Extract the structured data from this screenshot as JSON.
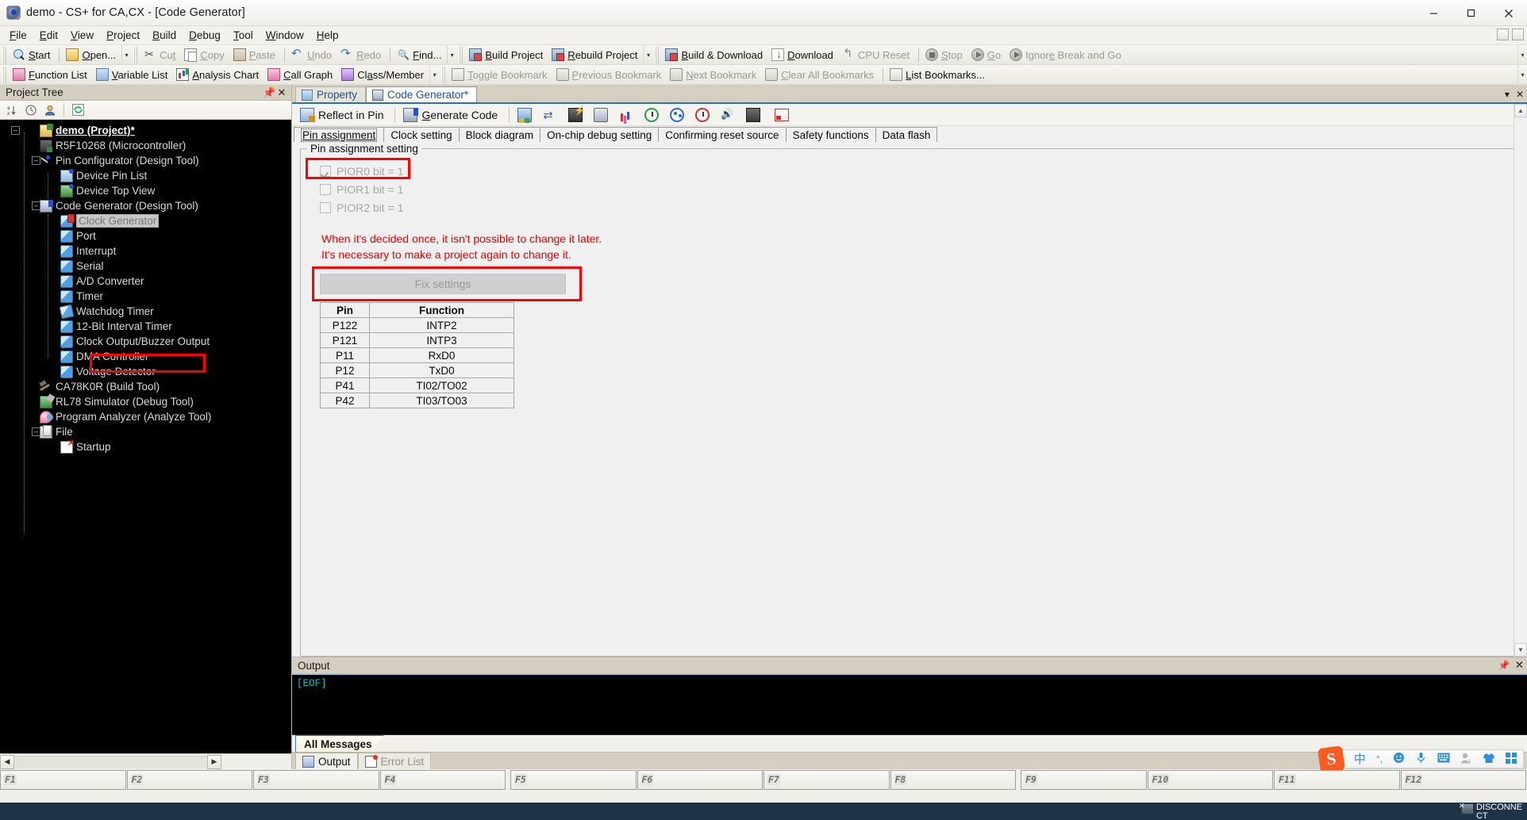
{
  "window": {
    "title": "demo - CS+ for CA,CX - [Code Generator]",
    "app_icon": "cs-plus-app-icon",
    "minimize": "minimize-icon",
    "maximize": "maximize-icon",
    "close": "close-icon"
  },
  "menubar": {
    "items": [
      {
        "label": "File",
        "mnemonic": "F"
      },
      {
        "label": "Edit",
        "mnemonic": "E"
      },
      {
        "label": "View",
        "mnemonic": "V"
      },
      {
        "label": "Project",
        "mnemonic": "P"
      },
      {
        "label": "Build",
        "mnemonic": "B"
      },
      {
        "label": "Debug",
        "mnemonic": "D"
      },
      {
        "label": "Tool",
        "mnemonic": "T"
      },
      {
        "label": "Window",
        "mnemonic": "W"
      },
      {
        "label": "Help",
        "mnemonic": "H"
      }
    ]
  },
  "toolbar_row1": [
    {
      "label": "Start",
      "icon": "start-icon",
      "disabled": false
    },
    {
      "label": "Open...",
      "icon": "open-folder-icon",
      "disabled": false
    },
    {
      "label": "Cut",
      "icon": "scissors-icon",
      "disabled": true
    },
    {
      "label": "Copy",
      "icon": "copy-icon",
      "disabled": true
    },
    {
      "label": "Paste",
      "icon": "paste-icon",
      "disabled": true
    },
    {
      "label": "Undo",
      "icon": "undo-icon",
      "disabled": true
    },
    {
      "label": "Redo",
      "icon": "redo-icon",
      "disabled": true
    },
    {
      "label": "Find...",
      "icon": "find-icon",
      "disabled": false
    },
    {
      "label": "Build Project",
      "icon": "build-project-icon",
      "disabled": false
    },
    {
      "label": "Rebuild Project",
      "icon": "rebuild-project-icon",
      "disabled": false
    },
    {
      "label": "Build & Download",
      "icon": "build-download-icon",
      "disabled": false
    },
    {
      "label": "Download",
      "icon": "download-icon",
      "disabled": false
    },
    {
      "label": "CPU Reset",
      "icon": "cpu-reset-icon",
      "disabled": true
    },
    {
      "label": "Stop",
      "icon": "stop-icon",
      "disabled": true
    },
    {
      "label": "Go",
      "icon": "go-icon",
      "disabled": true
    },
    {
      "label": "Ignore Break and Go",
      "icon": "ignore-break-go-icon",
      "disabled": true
    }
  ],
  "toolbar_row2": [
    {
      "label": "Function List",
      "icon": "function-list-icon",
      "disabled": false
    },
    {
      "label": "Variable List",
      "icon": "variable-list-icon",
      "disabled": false
    },
    {
      "label": "Analysis Chart",
      "icon": "analysis-chart-icon",
      "disabled": false
    },
    {
      "label": "Call Graph",
      "icon": "call-graph-icon",
      "disabled": false
    },
    {
      "label": "Class/Member",
      "icon": "class-member-icon",
      "disabled": false
    },
    {
      "label": "Toggle Bookmark",
      "icon": "toggle-bookmark-icon",
      "disabled": true
    },
    {
      "label": "Previous Bookmark",
      "icon": "previous-bookmark-icon",
      "disabled": true
    },
    {
      "label": "Next Bookmark",
      "icon": "next-bookmark-icon",
      "disabled": true
    },
    {
      "label": "Clear All Bookmarks",
      "icon": "clear-all-bookmarks-icon",
      "disabled": true
    },
    {
      "label": "List Bookmarks...",
      "icon": "list-bookmarks-icon",
      "disabled": false
    }
  ],
  "project_tree": {
    "title": "Project Tree",
    "pin_icon": "pin-icon",
    "close_icon": "close-icon",
    "toolbar_icons": [
      "sort-az-icon",
      "clock-icon",
      "user-icon",
      "refresh-icon"
    ],
    "nodes": [
      {
        "label": "demo (Project)*",
        "depth": 0,
        "icon": "project-icon",
        "expander": "-",
        "selected": false
      },
      {
        "label": "R5F10268 (Microcontroller)",
        "depth": 1,
        "icon": "microcontroller-icon",
        "expander": "",
        "selected": false
      },
      {
        "label": "Pin Configurator (Design Tool)",
        "depth": 1,
        "icon": "pin-configurator-icon",
        "expander": "-",
        "selected": false
      },
      {
        "label": "Device Pin List",
        "depth": 2,
        "icon": "device-pin-list-icon",
        "expander": "",
        "selected": false
      },
      {
        "label": "Device Top View",
        "depth": 2,
        "icon": "device-top-view-icon",
        "expander": "",
        "selected": false
      },
      {
        "label": "Code Generator (Design Tool)",
        "depth": 1,
        "icon": "code-generator-icon",
        "expander": "-",
        "selected": false
      },
      {
        "label": "Clock Generator",
        "depth": 2,
        "icon": "clock-generator-icon",
        "expander": "",
        "selected": true
      },
      {
        "label": "Port",
        "depth": 2,
        "icon": "port-icon",
        "expander": "",
        "selected": false
      },
      {
        "label": "Interrupt",
        "depth": 2,
        "icon": "interrupt-icon",
        "expander": "",
        "selected": false
      },
      {
        "label": "Serial",
        "depth": 2,
        "icon": "serial-icon",
        "expander": "",
        "selected": false
      },
      {
        "label": "A/D Converter",
        "depth": 2,
        "icon": "ad-converter-icon",
        "expander": "",
        "selected": false
      },
      {
        "label": "Timer",
        "depth": 2,
        "icon": "timer-icon",
        "expander": "",
        "selected": false
      },
      {
        "label": "Watchdog Timer",
        "depth": 2,
        "icon": "watchdog-timer-icon",
        "expander": "",
        "selected": false
      },
      {
        "label": "12-Bit Interval Timer",
        "depth": 2,
        "icon": "interval-timer-icon",
        "expander": "",
        "selected": false
      },
      {
        "label": "Clock Output/Buzzer Output",
        "depth": 2,
        "icon": "clock-output-icon",
        "expander": "",
        "selected": false
      },
      {
        "label": "DMA Controller",
        "depth": 2,
        "icon": "dma-controller-icon",
        "expander": "",
        "selected": false
      },
      {
        "label": "Voltage Detector",
        "depth": 2,
        "icon": "voltage-detector-icon",
        "expander": "",
        "selected": false
      },
      {
        "label": "CA78K0R (Build Tool)",
        "depth": 1,
        "icon": "build-tool-icon",
        "expander": "",
        "selected": false
      },
      {
        "label": "RL78 Simulator (Debug Tool)",
        "depth": 1,
        "icon": "debug-tool-icon",
        "expander": "",
        "selected": false
      },
      {
        "label": "Program Analyzer (Analyze Tool)",
        "depth": 1,
        "icon": "analyze-tool-icon",
        "expander": "",
        "selected": false
      },
      {
        "label": "File",
        "depth": 1,
        "icon": "file-folder-icon",
        "expander": "-",
        "selected": false
      },
      {
        "label": "Startup",
        "depth": 2,
        "icon": "startup-file-icon",
        "expander": "",
        "selected": false
      }
    ],
    "hscroll": {
      "left": "◀",
      "right": "▶"
    }
  },
  "doc_tabs": [
    {
      "label": "Property",
      "icon": "property-icon",
      "active": false
    },
    {
      "label": "Code Generator*",
      "icon": "code-generator-icon",
      "active": true
    }
  ],
  "doc_tabstrip_right": [
    "▼",
    "✕"
  ],
  "code_generator": {
    "toolbar": [
      {
        "label": "Reflect in Pin",
        "icon": "reflect-in-pin-icon"
      },
      {
        "label": "Generate Code",
        "icon": "generate-code-icon"
      }
    ],
    "toolbar_icons": [
      "peripheral-functions-icon",
      "clock-generator-icon",
      "port-icon",
      "interrupt-icon",
      "ad-converter-icon",
      "timer-icon",
      "serial-icon",
      "watchdog-timer-icon",
      "buzzer-output-icon",
      "dma-controller-icon",
      "voltage-detector-icon"
    ],
    "subtabs": [
      {
        "label": "Pin assignment",
        "active": true
      },
      {
        "label": "Clock setting",
        "active": false
      },
      {
        "label": "Block diagram",
        "active": false
      },
      {
        "label": "On-chip debug setting",
        "active": false
      },
      {
        "label": "Confirming reset source",
        "active": false
      },
      {
        "label": "Safety functions",
        "active": false
      },
      {
        "label": "Data flash",
        "active": false
      }
    ],
    "group_legend": "Pin assignment setting",
    "checkboxes": [
      {
        "label": "PIOR0 bit = 1",
        "checked": true,
        "disabled": true,
        "highlighted": true
      },
      {
        "label": "PIOR1 bit = 1",
        "checked": false,
        "disabled": true,
        "highlighted": false
      },
      {
        "label": "PIOR2 bit = 1",
        "checked": false,
        "disabled": true,
        "highlighted": false
      }
    ],
    "warning_lines": [
      "When it's decided once, it isn't possible to change it later.",
      "It's necessary to make a project again to change it."
    ],
    "warning_color": "#e60000",
    "fix_settings_button": {
      "label": "Fix settings",
      "disabled": true,
      "highlighted": true
    },
    "pin_table": {
      "headers": [
        "Pin",
        "Function"
      ],
      "rows": [
        [
          "P122",
          "INTP2"
        ],
        [
          "P121",
          "INTP3"
        ],
        [
          "P11",
          "RxD0"
        ],
        [
          "P12",
          "TxD0"
        ],
        [
          "P41",
          "TI02/TO02"
        ],
        [
          "P42",
          "TI03/TO03"
        ]
      ]
    },
    "scroll_up": "▲",
    "scroll_down": "▼"
  },
  "output": {
    "title": "Output",
    "pin_icon": "pin-icon",
    "close_icon": "close-icon",
    "content": "[EOF]",
    "content_color": "#13c0c0",
    "all_messages_tab": "All Messages"
  },
  "bottom_tabs": [
    {
      "label": "Output",
      "icon": "output-icon",
      "active": true
    },
    {
      "label": "Error List",
      "icon": "error-list-icon",
      "active": false
    }
  ],
  "ime": {
    "logo": "S",
    "icons": [
      "chinese-mode-icon",
      "punctuation-icon",
      "emoji-icon",
      "microphone-icon",
      "soft-keyboard-icon",
      "user-icon",
      "skin-icon",
      "apps-icon"
    ],
    "icon_glyphs": [
      "中",
      "°,",
      "☻",
      "Ἲ4",
      "⌨",
      "●",
      "▼",
      "▦"
    ]
  },
  "function_keys": [
    {
      "label": "F1"
    },
    {
      "label": "F2"
    },
    {
      "label": "F3"
    },
    {
      "label": "F4"
    },
    {
      "label": "F5"
    },
    {
      "label": "F6"
    },
    {
      "label": "F7"
    },
    {
      "label": "F8"
    },
    {
      "label": "F9"
    },
    {
      "label": "F10"
    },
    {
      "label": "F11"
    },
    {
      "label": "F12"
    }
  ],
  "statusbar": {
    "disconnect_line1": "DISCONNE",
    "disconnect_line2": "CT",
    "disconnect_icon": "disconnect-icon"
  },
  "annotations": {
    "color": "#ff0000",
    "boxes": [
      {
        "target": "clock-generator-tree-node"
      },
      {
        "target": "pior0-checkbox"
      },
      {
        "target": "fix-settings-button"
      }
    ]
  }
}
